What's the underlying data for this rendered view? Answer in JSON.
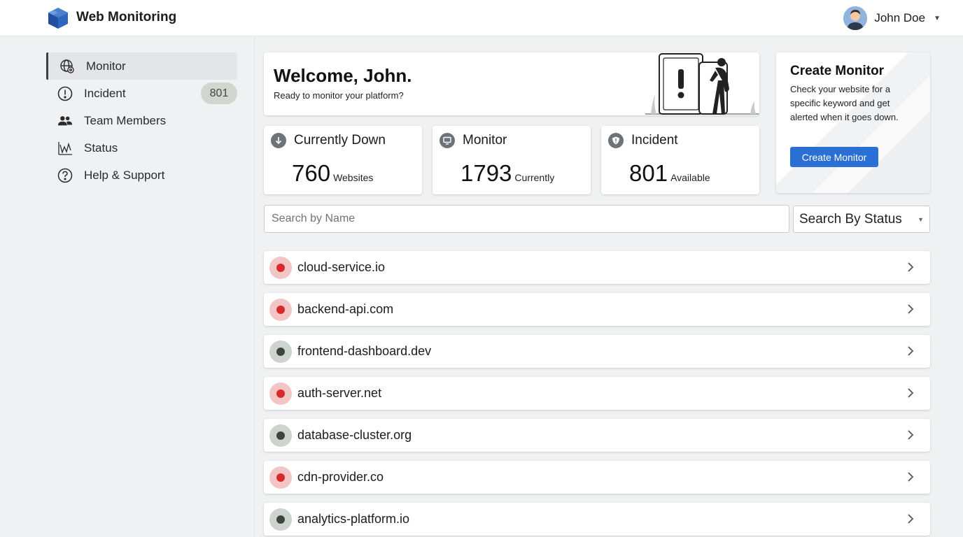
{
  "header": {
    "title": "Web Monitoring",
    "user_name": "John Doe"
  },
  "sidebar": {
    "items": [
      {
        "label": "Monitor",
        "icon": "globe-gear-icon",
        "active": true
      },
      {
        "label": "Incident",
        "icon": "alert-circle-icon",
        "badge": "801"
      },
      {
        "label": "Team Members",
        "icon": "people-icon"
      },
      {
        "label": "Status",
        "icon": "status-chart-icon"
      },
      {
        "label": "Help & Support",
        "icon": "question-circle-icon"
      }
    ]
  },
  "welcome": {
    "title": "Welcome, John.",
    "subtitle": "Ready to monitor your platform?"
  },
  "create_monitor": {
    "title": "Create Monitor",
    "description": "Check your website for a specific keyword and get alerted when it goes down.",
    "button_label": "Create Monitor",
    "button_color": "#2a6fd4"
  },
  "stats": [
    {
      "title": "Currently Down",
      "value": "760",
      "unit": "Websites",
      "icon": "arrow-down-circle-icon"
    },
    {
      "title": "Monitor",
      "value": "1793",
      "unit": "Currently",
      "icon": "monitor-icon"
    },
    {
      "title": "Incident",
      "value": "801",
      "unit": "Available",
      "icon": "shield-alert-icon"
    }
  ],
  "filters": {
    "search_placeholder": "Search by Name",
    "status_selected": "Search By Status"
  },
  "sites": [
    {
      "name": "cloud-service.io",
      "status": "down"
    },
    {
      "name": "backend-api.com",
      "status": "down"
    },
    {
      "name": "frontend-dashboard.dev",
      "status": "up"
    },
    {
      "name": "auth-server.net",
      "status": "down"
    },
    {
      "name": "database-cluster.org",
      "status": "up"
    },
    {
      "name": "cdn-provider.co",
      "status": "down"
    },
    {
      "name": "analytics-platform.io",
      "status": "up"
    }
  ],
  "colors": {
    "down_dot": "#d42a2a",
    "up_dot": "#3e4441",
    "accent": "#2a6fd4"
  }
}
